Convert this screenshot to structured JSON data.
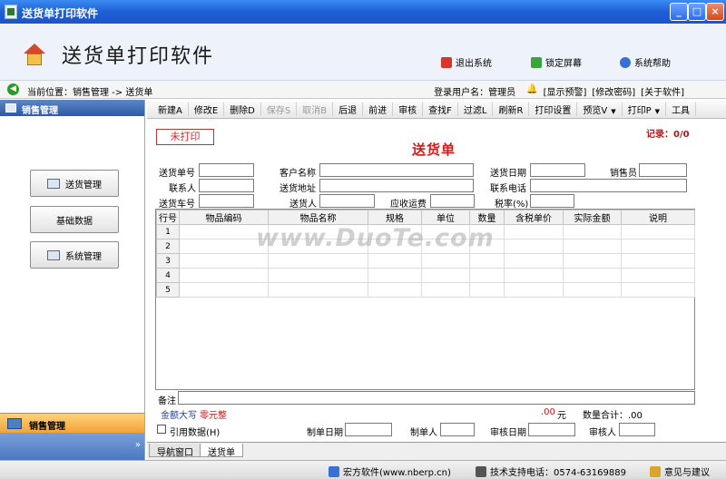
{
  "window": {
    "title": "送货单打印软件",
    "min": "_",
    "max": "□",
    "close": "×"
  },
  "header": {
    "app_title": "送货单打印软件",
    "exit_label": "退出系统",
    "lock_label": "锁定屏幕",
    "help_label": "系统帮助"
  },
  "location": {
    "current": "当前位置：销售管理 -> 送货单",
    "user": "登录用户名：管理员",
    "show_warning": "[显示预警]",
    "change_password": "[修改密码]",
    "about": "[关于软件]"
  },
  "sidebar": {
    "title": "销售管理",
    "buttons": [
      "送货管理",
      "基础数据",
      "系统管理"
    ],
    "footer": "销售管理",
    "collapse": "»"
  },
  "toolbar": {
    "items": [
      {
        "label": "新建A",
        "enabled": true
      },
      {
        "label": "修改E",
        "enabled": true
      },
      {
        "label": "删除D",
        "enabled": true
      },
      {
        "label": "保存S",
        "enabled": false
      },
      {
        "label": "取消B",
        "enabled": false
      },
      {
        "label": "后退",
        "enabled": true
      },
      {
        "label": "前进",
        "enabled": true
      },
      {
        "label": "审核",
        "enabled": true
      },
      {
        "label": "查找F",
        "enabled": true
      },
      {
        "label": "过滤L",
        "enabled": true
      },
      {
        "label": "刷新R",
        "enabled": true
      },
      {
        "label": "打印设置",
        "enabled": true
      },
      {
        "label": "预览V",
        "enabled": true,
        "dropdown": true
      },
      {
        "label": "打印P",
        "enabled": true,
        "dropdown": true
      },
      {
        "label": "工具",
        "enabled": true
      }
    ]
  },
  "form": {
    "status": "未打印",
    "title": "送货单",
    "record": "记录：0/0",
    "fields": {
      "order_no": "送货单号",
      "customer_name": "客户名称",
      "delivery_date": "送货日期",
      "salesman": "销售员",
      "contact": "联系人",
      "delivery_address": "送货地址",
      "phone": "联系电话",
      "vehicle_no": "送货车号",
      "deliverer": "送货人",
      "freight": "应收运费",
      "tax_rate": "税率(%)"
    },
    "grid": {
      "columns": [
        "行号",
        "物品编码",
        "物品名称",
        "规格",
        "单位",
        "数量",
        "含税单价",
        "实际金额",
        "说明"
      ],
      "rows": [
        "1",
        "2",
        "3",
        "4",
        "5"
      ]
    },
    "note_label": "备注",
    "amount_label": "金额大写",
    "amount_value": "零元整",
    "sum_value": ".00",
    "sum_unit": "元",
    "qty_label": "数量合计：.00",
    "cite_label": "引用数据(H)",
    "create_date": "制单日期",
    "creator": "制单人",
    "review_date": "审核日期",
    "reviewer": "审核人"
  },
  "tabs": [
    "导航窗口",
    "送货单"
  ],
  "statusbar": {
    "company": "宏方软件(www.nberp.cn)",
    "support": "技术支持电话：0574-63169889",
    "feedback": "意见与建议"
  },
  "watermark": "www.DuoTe.com"
}
